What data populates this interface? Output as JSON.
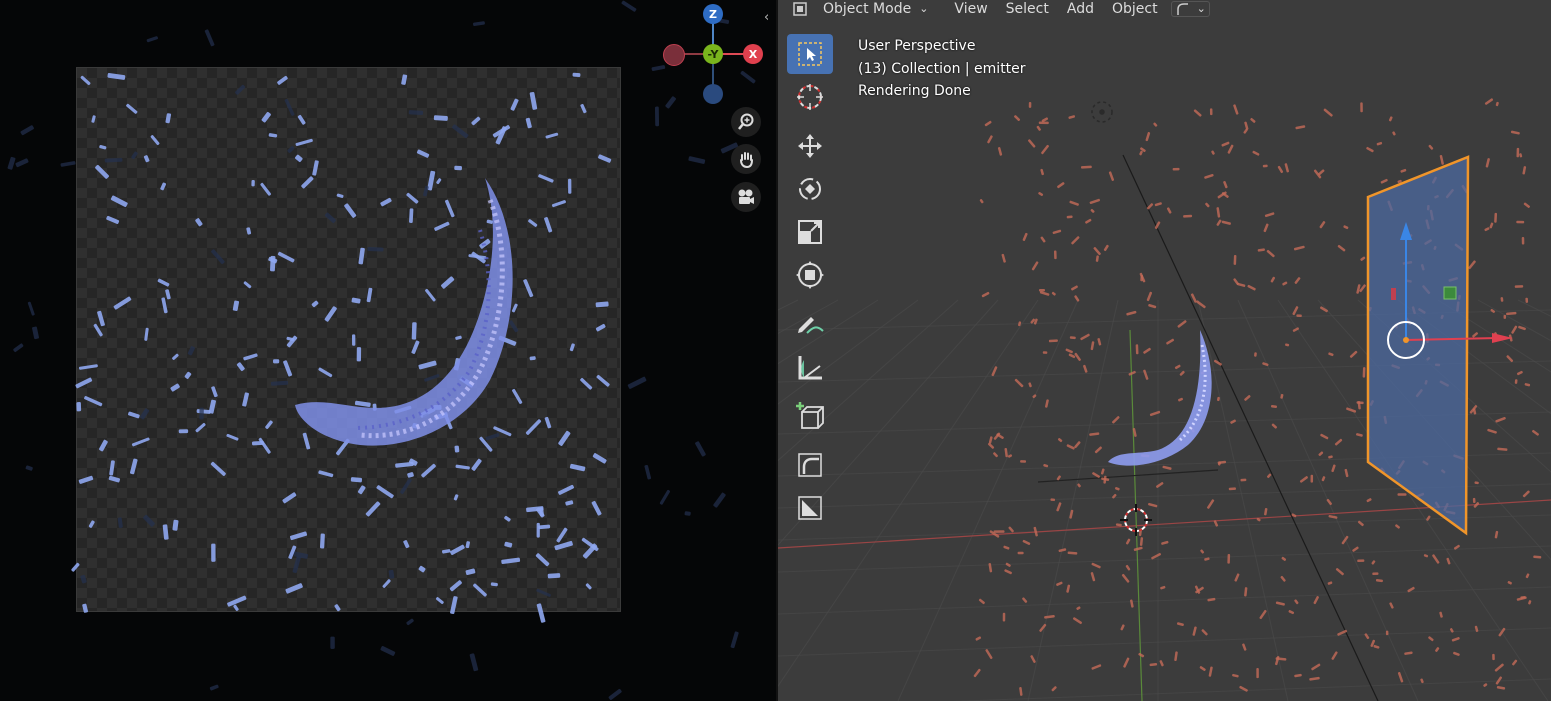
{
  "header": {
    "mode": "Object Mode",
    "menus": [
      "View",
      "Select",
      "Add",
      "Object"
    ]
  },
  "overlay": {
    "line1": "User Perspective",
    "line2": "(13) Collection | emitter",
    "line3": "Rendering Done"
  },
  "gizmo": {
    "z": "Z",
    "y": "-Y",
    "x": "X"
  },
  "toolbar": {
    "tools": [
      "select-box",
      "cursor",
      "move",
      "rotate",
      "scale",
      "transform",
      "annotate",
      "measure",
      "add-cube",
      "extrude-curve",
      "image-crop"
    ],
    "active": "select-box"
  },
  "colors": {
    "accent": "#4772b3",
    "selection_outline": "#f0952a",
    "particles_render": "#8fa7f0",
    "particles_viewport": "#c46a57"
  }
}
